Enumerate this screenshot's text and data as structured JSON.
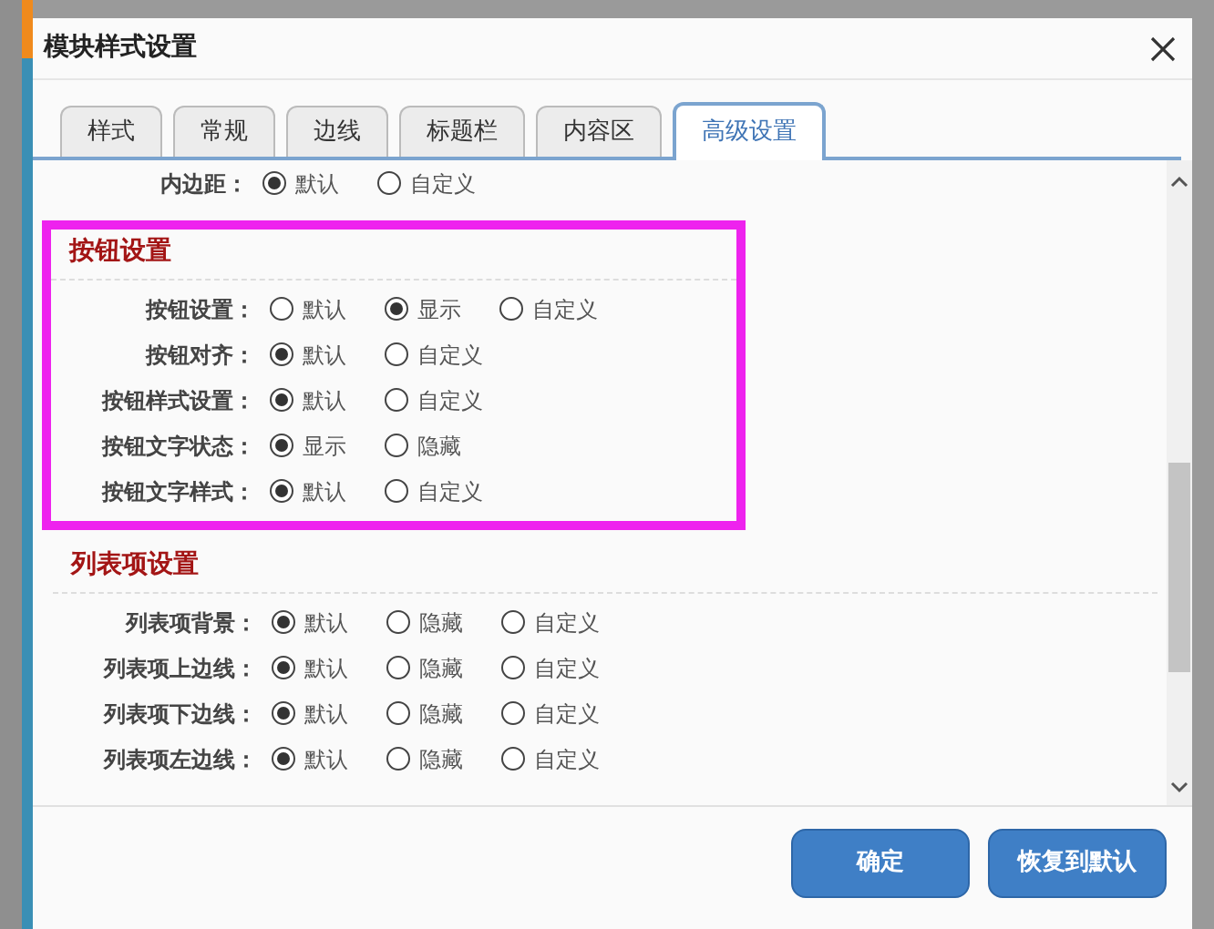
{
  "dialog": {
    "title": "模块样式设置"
  },
  "tabs": [
    {
      "label": "样式",
      "selected": false
    },
    {
      "label": "常规",
      "selected": false
    },
    {
      "label": "边线",
      "selected": false
    },
    {
      "label": "标题栏",
      "selected": false
    },
    {
      "label": "内容区",
      "selected": false
    },
    {
      "label": "高级设置",
      "selected": true
    }
  ],
  "top_rows": [
    {
      "label": "内边距：",
      "options": [
        {
          "label": "默认",
          "selected": true
        },
        {
          "label": "自定义",
          "selected": false
        }
      ]
    }
  ],
  "sections": [
    {
      "title": "按钮设置",
      "highlighted": true,
      "rows": [
        {
          "label": "按钮设置：",
          "options": [
            {
              "label": "默认",
              "selected": false
            },
            {
              "label": "显示",
              "selected": true
            },
            {
              "label": "自定义",
              "selected": false
            }
          ]
        },
        {
          "label": "按钮对齐：",
          "options": [
            {
              "label": "默认",
              "selected": true
            },
            {
              "label": "自定义",
              "selected": false
            }
          ]
        },
        {
          "label": "按钮样式设置：",
          "options": [
            {
              "label": "默认",
              "selected": true
            },
            {
              "label": "自定义",
              "selected": false
            }
          ]
        },
        {
          "label": "按钮文字状态：",
          "options": [
            {
              "label": "显示",
              "selected": true
            },
            {
              "label": "隐藏",
              "selected": false
            }
          ]
        },
        {
          "label": "按钮文字样式：",
          "options": [
            {
              "label": "默认",
              "selected": true
            },
            {
              "label": "自定义",
              "selected": false
            }
          ]
        }
      ]
    },
    {
      "title": "列表项设置",
      "highlighted": false,
      "rows": [
        {
          "label": "列表项背景：",
          "options": [
            {
              "label": "默认",
              "selected": true
            },
            {
              "label": "隐藏",
              "selected": false
            },
            {
              "label": "自定义",
              "selected": false
            }
          ]
        },
        {
          "label": "列表项上边线：",
          "options": [
            {
              "label": "默认",
              "selected": true
            },
            {
              "label": "隐藏",
              "selected": false
            },
            {
              "label": "自定义",
              "selected": false
            }
          ]
        },
        {
          "label": "列表项下边线：",
          "options": [
            {
              "label": "默认",
              "selected": true
            },
            {
              "label": "隐藏",
              "selected": false
            },
            {
              "label": "自定义",
              "selected": false
            }
          ]
        },
        {
          "label": "列表项左边线：",
          "options": [
            {
              "label": "默认",
              "selected": true
            },
            {
              "label": "隐藏",
              "selected": false
            },
            {
              "label": "自定义",
              "selected": false
            }
          ]
        }
      ]
    }
  ],
  "buttons": [
    "确定",
    "恢复到默认"
  ]
}
